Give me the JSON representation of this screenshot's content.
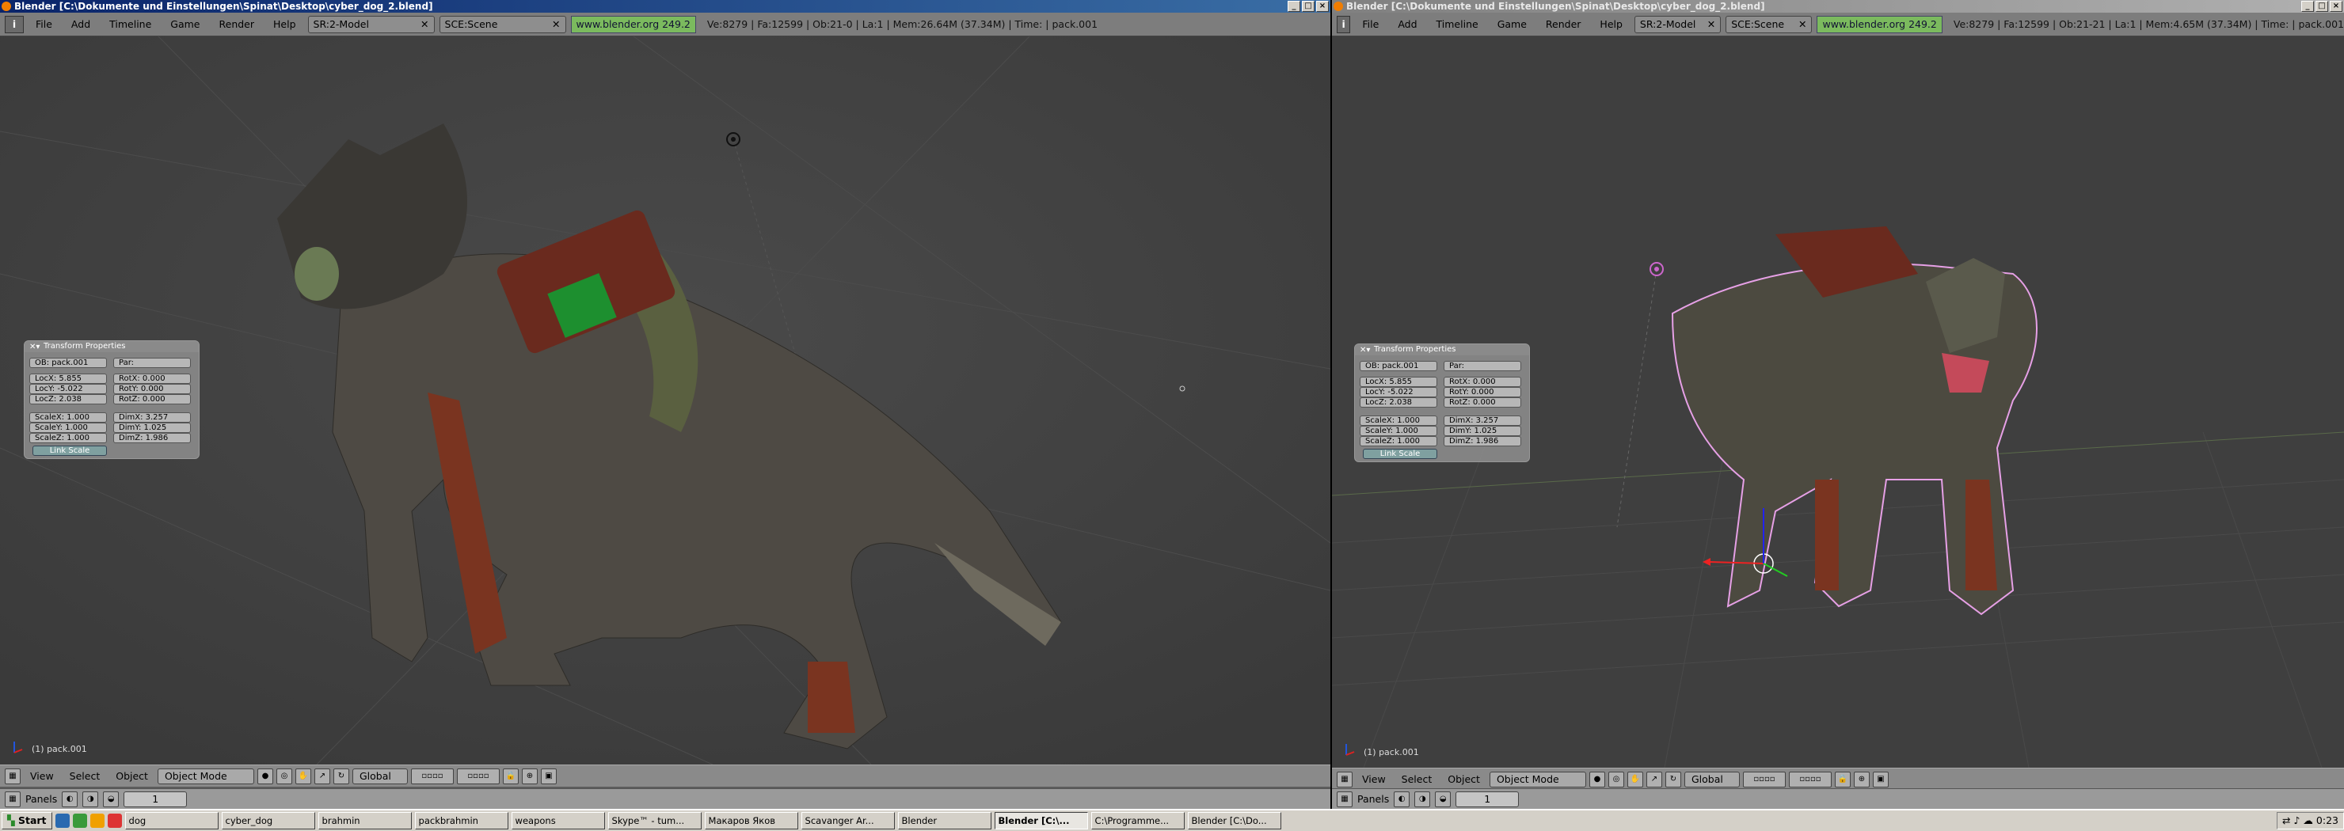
{
  "left": {
    "title": "Blender [C:\\Dokumente und Einstellungen\\Spinat\\Desktop\\cyber_dog_2.blend]",
    "screen": "SR:2-Model",
    "scene": "SCE:Scene",
    "url": "www.blender.org 249.2",
    "stats": "Ve:8279 | Fa:12599 | Ob:21-0 | La:1  | Mem:26.64M (37.34M)  | Time: | pack.001",
    "object_label": "(1) pack.001"
  },
  "right": {
    "title": "Blender [C:\\Dokumente und Einstellungen\\Spinat\\Desktop\\cyber_dog_2.blend]",
    "screen": "SR:2-Model",
    "scene": "SCE:Scene",
    "url": "www.blender.org 249.2",
    "stats": "Ve:8279 | Fa:12599 | Ob:21-21 | La:1  | Mem:4.65M (37.34M)  | Time: | pack.001",
    "object_label": "(1) pack.001"
  },
  "menus": [
    "File",
    "Add",
    "Timeline",
    "Game",
    "Render",
    "Help"
  ],
  "view_menus": [
    "View",
    "Select",
    "Object"
  ],
  "mode": "Object Mode",
  "orientation": "Global",
  "panels_label": "Panels",
  "frame": "1",
  "transform": {
    "title": "Transform Properties",
    "ob": "OB: pack.001",
    "par": "Par:",
    "locx": "LocX: 5.855",
    "locy": "LocY: -5.022",
    "locz": "LocZ: 2.038",
    "rotx": "RotX: 0.000",
    "roty": "RotY: 0.000",
    "rotz": "RotZ: 0.000",
    "scalex": "ScaleX: 1.000",
    "scaley": "ScaleY: 1.000",
    "scalez": "ScaleZ: 1.000",
    "dimx": "DimX: 3.257",
    "dimy": "DimY: 1.025",
    "dimz": "DimZ: 1.986",
    "link_scale": "Link Scale"
  },
  "taskbar": {
    "start": "Start",
    "items": [
      "dog",
      "cyber_dog",
      "brahmin",
      "packbrahmin",
      "weapons",
      "Skype™ - tum...",
      "Макаров Яков",
      "Scavanger Ar...",
      "Blender",
      "Blender [C:\\...",
      "C:\\Programme...",
      "Blender [C:\\Do..."
    ],
    "active_index": 9,
    "clock": "0:23"
  }
}
